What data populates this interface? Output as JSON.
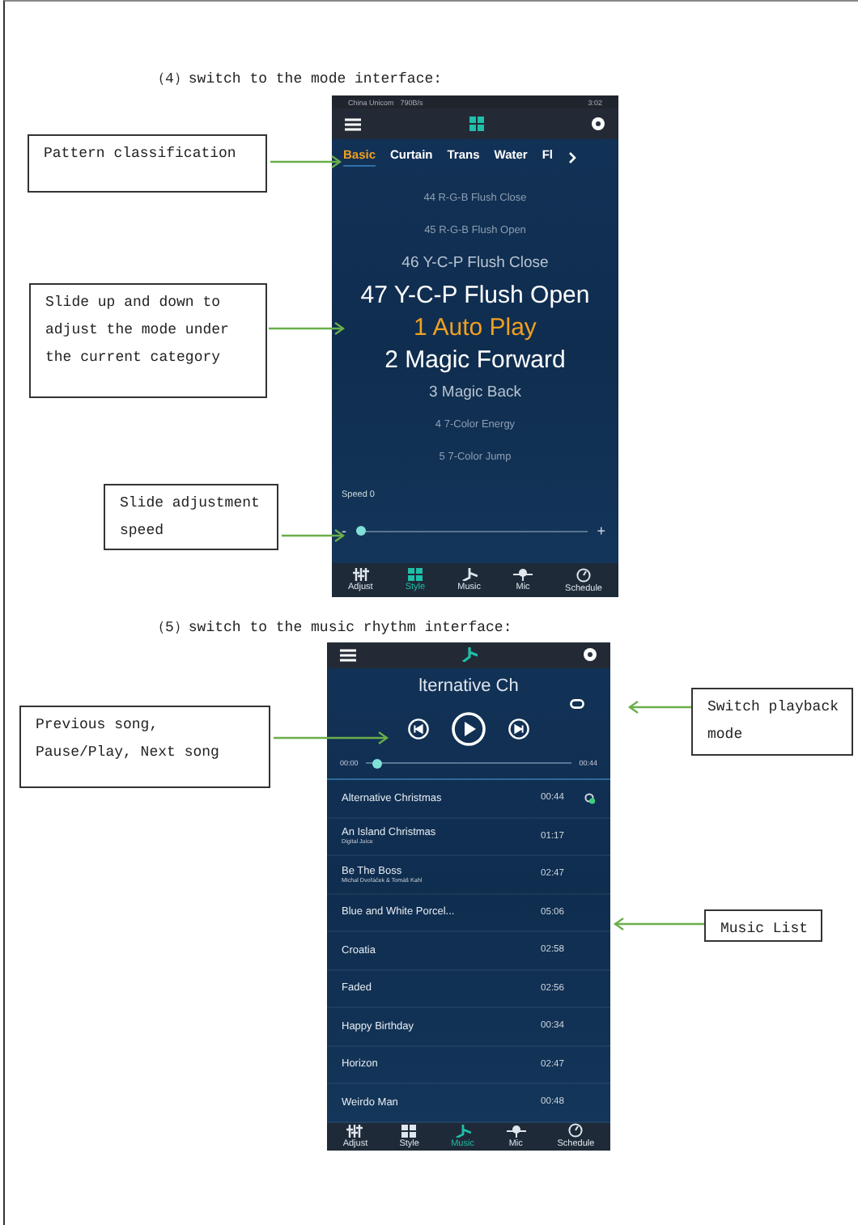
{
  "sections": [
    {
      "heading": "（4）switch to the mode interface:",
      "phone": {
        "kind": "mode",
        "status_bar": {
          "carrier": "China Unicom",
          "speed": "790B/s",
          "time": "3:02"
        },
        "tabs": [
          {
            "label": "Basic",
            "selected": true
          },
          {
            "label": "Curtain",
            "selected": false
          },
          {
            "label": "Trans",
            "selected": false
          },
          {
            "label": "Water",
            "selected": false
          },
          {
            "label": "Fl",
            "selected": false
          }
        ],
        "modes": [
          {
            "label": "44 R-G-B Flush Close",
            "selected": false
          },
          {
            "label": "45 R-G-B Flush Open",
            "selected": false
          },
          {
            "label": "46 Y-C-P Flush Close",
            "selected": false
          },
          {
            "label": "47 Y-C-P Flush Open",
            "selected": false
          },
          {
            "label": "1 Auto Play",
            "selected": true
          },
          {
            "label": "2 Magic Forward",
            "selected": false
          },
          {
            "label": "3 Magic Back",
            "selected": false
          },
          {
            "label": "4 7-Color Energy",
            "selected": false
          },
          {
            "label": "5 7-Color Jump",
            "selected": false
          }
        ],
        "speed": {
          "label": "Speed 0",
          "minus": "-",
          "plus": "+",
          "level": 0
        },
        "nav": [
          {
            "label": "Adjust",
            "selected": false
          },
          {
            "label": "Style",
            "selected": true
          },
          {
            "label": "Music",
            "selected": false
          },
          {
            "label": "Mic",
            "selected": false
          },
          {
            "label": "Schedule",
            "selected": false
          }
        ]
      }
    },
    {
      "heading": "（5）switch to the music rhythm interface:",
      "phone": {
        "kind": "music",
        "title": "lternative Ch",
        "progress": {
          "start": "00:00",
          "end": "00:44",
          "level": 0.03
        },
        "songs": [
          {
            "title": "Alternative Christmas",
            "duration": "00:44",
            "playing": true
          },
          {
            "title": "An Island Christmas",
            "artist": "Digital Juice",
            "duration": "01:17",
            "playing": false
          },
          {
            "title": "Be The Boss",
            "artist": "Michal Dvořáček & Tomáš Kahl",
            "duration": "02:47",
            "playing": false
          },
          {
            "title": "Blue and White Porcel...",
            "duration": "05:06",
            "playing": false
          },
          {
            "title": "Croatia",
            "duration": "02:58",
            "playing": false
          },
          {
            "title": "Faded",
            "duration": "02:56",
            "playing": false
          },
          {
            "title": "Happy Birthday",
            "duration": "00:34",
            "playing": false
          },
          {
            "title": "Horizon",
            "duration": "02:47",
            "playing": false
          },
          {
            "title": "Weirdo Man",
            "duration": "00:48",
            "playing": false
          }
        ],
        "nav": [
          {
            "label": "Adjust",
            "selected": false
          },
          {
            "label": "Style",
            "selected": false
          },
          {
            "label": "Music",
            "selected": true
          },
          {
            "label": "Mic",
            "selected": false
          },
          {
            "label": "Schedule",
            "selected": false
          }
        ]
      }
    }
  ],
  "callouts": [
    {
      "text": "Pattern classification"
    },
    {
      "text": "Slide up and down to adjust the mode under the current category"
    },
    {
      "text": "Slide adjustment speed"
    },
    {
      "text": "Previous song, Pause/Play, Next song"
    },
    {
      "text": "Switch playback mode"
    },
    {
      "text": "Music List"
    }
  ]
}
